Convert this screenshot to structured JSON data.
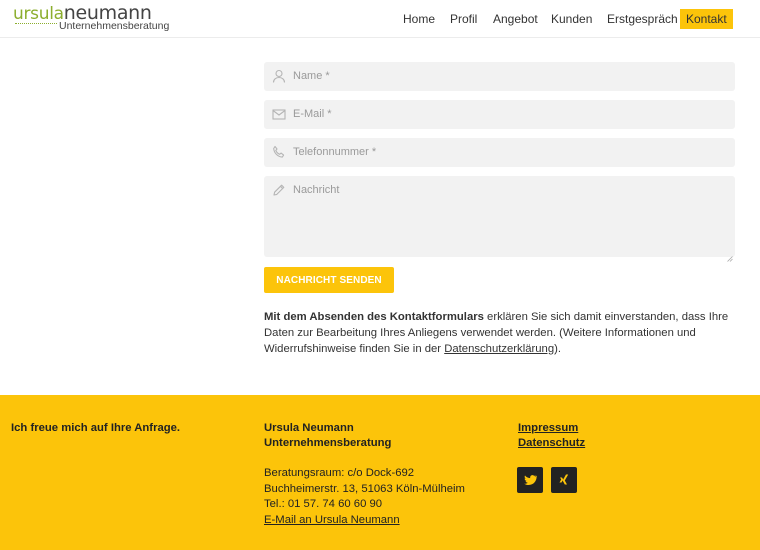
{
  "brand": {
    "first_name": "ursula",
    "last_name": "neumann",
    "subtitle": "Unternehmensberatung",
    "accent_color": "#fcc40a",
    "logo_green": "#8cae2e"
  },
  "nav": {
    "items": [
      {
        "label": "Home"
      },
      {
        "label": "Profil"
      },
      {
        "label": "Angebot"
      },
      {
        "label": "Kunden"
      },
      {
        "label": "Erstgespräch"
      },
      {
        "label": "Kontakt",
        "active": true
      }
    ]
  },
  "form": {
    "name_placeholder": "Name *",
    "email_placeholder": "E-Mail *",
    "phone_placeholder": "Telefonnummer *",
    "message_placeholder": "Nachricht",
    "submit_label": "NACHRICHT SENDEN",
    "icons": [
      "user-icon",
      "envelope-icon",
      "phone-icon",
      "pencil-icon"
    ]
  },
  "consent": {
    "bold": "Mit dem Absenden des Kontaktformulars",
    "text": " erklären Sie sich damit einverstanden, dass Ihre Daten zur Bearbeitung Ihres Anliegens verwendet werden. (Weitere Informationen und Widerrufshinweise finden Sie in der ",
    "link": "Datenschutzerklärung",
    "end": ")."
  },
  "footer": {
    "tagline": "Ich freue mich auf Ihre Anfrage.",
    "company_line1": "Ursula Neumann",
    "company_line2": "Unternehmensberatung",
    "address_line1": "Beratungsraum: c/o Dock-692",
    "address_line2": "Buchheimerstr. 13, 51063 Köln-Mülheim",
    "phone": "Tel.: 01 57. 74 60 60 90",
    "email_link": "E-Mail an Ursula Neumann",
    "impressum": "Impressum",
    "datenschutz": "Datenschutz",
    "social": [
      "twitter-icon",
      "xing-icon"
    ]
  }
}
